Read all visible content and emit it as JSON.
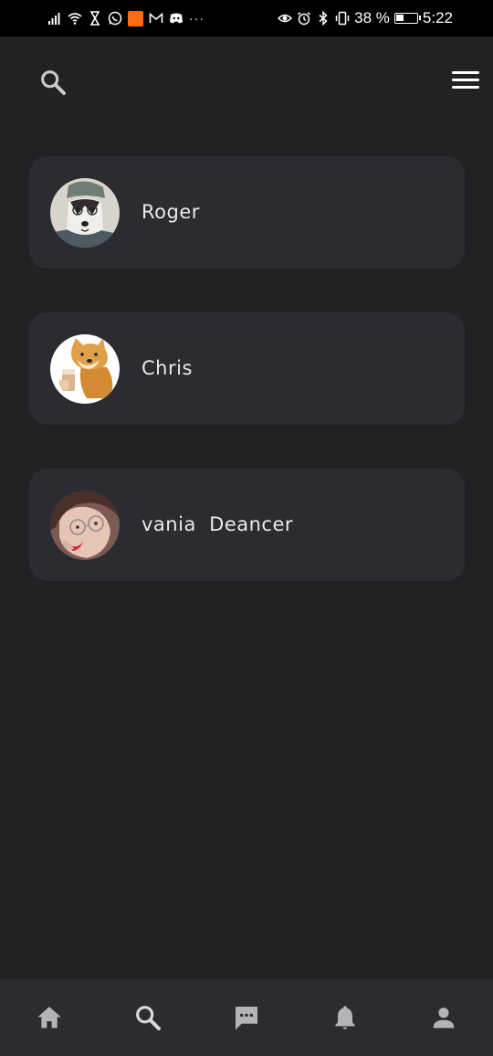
{
  "status_bar": {
    "battery_percent": "38 %",
    "time": "5:22",
    "more_dots": "···",
    "left_icons": [
      "signal-icon",
      "wifi-icon",
      "hourglass-icon",
      "whatsapp-icon",
      "aliexpress-icon",
      "gmail-icon",
      "discord-icon"
    ],
    "right_icons": [
      "eye-icon",
      "alarm-icon",
      "bluetooth-icon",
      "vibrate-icon",
      "battery-icon"
    ]
  },
  "top_bar": {
    "search_icon": "search-icon",
    "menu_icon": "hamburger-menu-icon"
  },
  "contacts": [
    {
      "name": "Roger",
      "avatar": "husky-avatar"
    },
    {
      "name": "Chris",
      "avatar": "shiba-avatar"
    },
    {
      "name": "vania  Deancer",
      "avatar": "person-avatar"
    }
  ],
  "bottom_nav": {
    "items": [
      "home-icon",
      "search-icon",
      "chat-icon",
      "bell-icon",
      "person-icon"
    ]
  },
  "colors": {
    "background": "#222224",
    "card": "#2b2b32",
    "nav_background": "#2b2b32",
    "nav_icon": "#b3b3b8",
    "text": "#e9e9ee"
  }
}
